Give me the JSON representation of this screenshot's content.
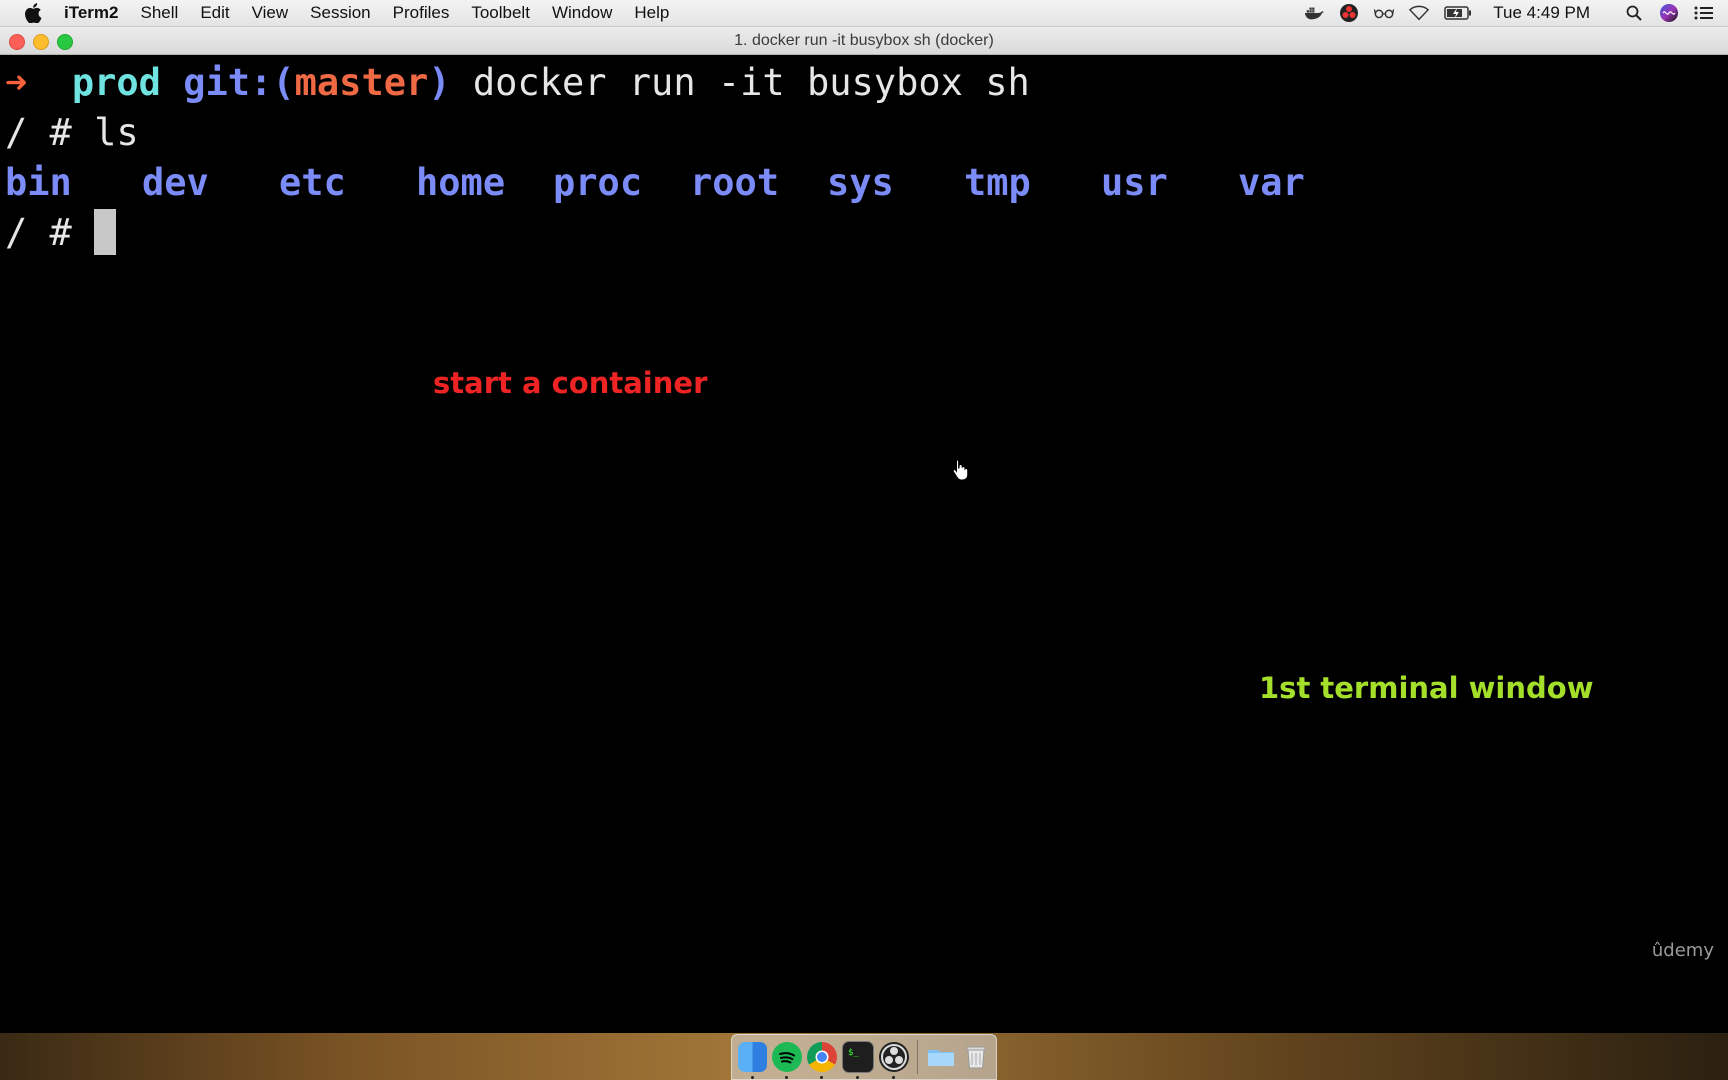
{
  "menubar": {
    "apple_icon": "apple-icon",
    "app_name": "iTerm2",
    "items": [
      "Shell",
      "Edit",
      "View",
      "Session",
      "Profiles",
      "Toolbelt",
      "Window",
      "Help"
    ],
    "status_icons": [
      "docker-icon",
      "obs-icon",
      "glasses-icon",
      "wifi-icon",
      "battery-icon"
    ],
    "clock": "Tue 4:49 PM",
    "right_icons": [
      "spotlight-search-icon",
      "siri-icon",
      "notification-center-icon"
    ]
  },
  "window": {
    "title": "1. docker run -it busybox sh (docker)"
  },
  "terminal": {
    "prompt_arrow": "➜",
    "prompt_dir": "prod",
    "prompt_git": "git:(",
    "prompt_branch": "master",
    "prompt_git_close": ")",
    "command": "docker run -it busybox sh",
    "line2": "/ # ls",
    "ls_output": [
      "bin",
      "dev",
      "etc",
      "home",
      "proc",
      "root",
      "sys",
      "tmp",
      "usr",
      "var"
    ],
    "line4_prompt": "/ # "
  },
  "annotations": {
    "red_note": "start a container",
    "green_note": "1st terminal window"
  },
  "watermark": "ûdemy",
  "colors": {
    "arrow": "#f4613a",
    "dir": "#6fe3df",
    "git_and_ls": "#7b8bf7",
    "branch": "#ef6a44",
    "red_note": "#ee2424",
    "green_note": "#a4e02a"
  },
  "dock": {
    "apps": [
      "finder-icon",
      "spotify-icon",
      "chrome-icon",
      "terminal-icon",
      "obs-icon",
      "folder-icon",
      "trash-icon"
    ]
  }
}
